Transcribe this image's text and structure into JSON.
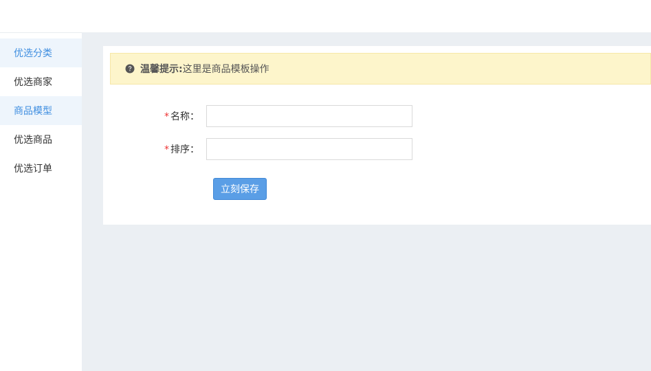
{
  "sidebar": {
    "items": [
      {
        "label": "优选分类"
      },
      {
        "label": "优选商家"
      },
      {
        "label": "商品模型"
      },
      {
        "label": "优选商品"
      },
      {
        "label": "优选订单"
      }
    ]
  },
  "tip": {
    "icon": "question-circle-icon",
    "title": "温馨提示:",
    "text": "这里是商品模板操作"
  },
  "form": {
    "required_mark": "*",
    "name_label": "名称：",
    "name_value": "",
    "sort_label": "排序：",
    "sort_value": "",
    "save_label": "立刻保存"
  },
  "colors": {
    "accent": "#3f8ee0",
    "button": "#5a9ee6",
    "tip_background": "#fdf5cb",
    "main_background": "#ebeff3"
  }
}
